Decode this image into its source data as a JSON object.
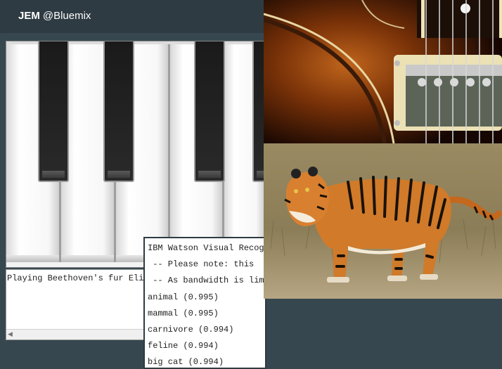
{
  "header": {
    "brand_bold": "JEM",
    "brand_rest": "@Bluemix"
  },
  "status": {
    "text": "Playing Beethoven's fur Elise"
  },
  "watson": {
    "lines": [
      "IBM Watson Visual Recognition",
      " -- Please note: this",
      " -- As bandwidth is limited",
      "animal (0.995)",
      "mammal (0.995)",
      "carnivore (0.994)",
      "feline (0.994)",
      "big cat (0.994)"
    ]
  },
  "colors": {
    "background": "#37474f",
    "topbar": "#2e3b42"
  }
}
